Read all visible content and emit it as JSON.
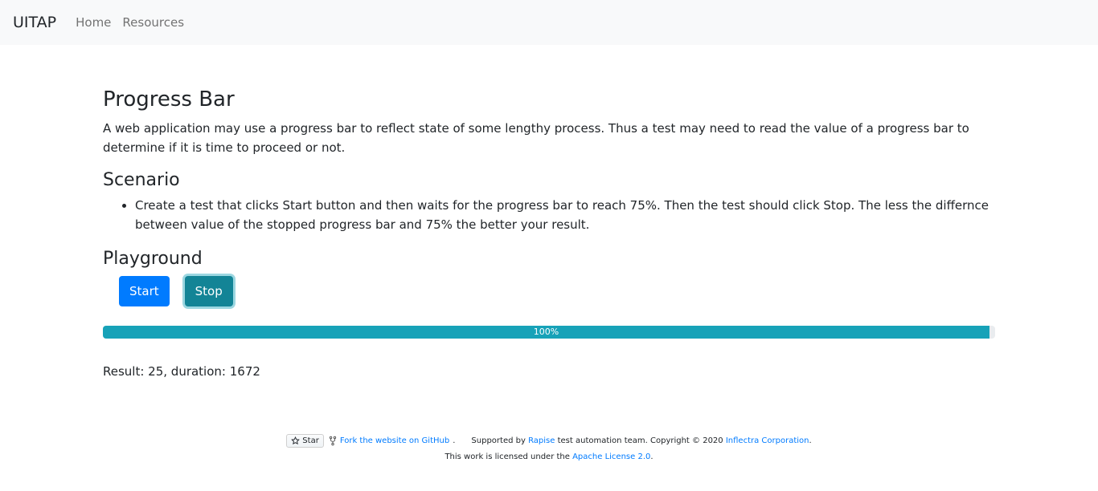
{
  "navbar": {
    "brand": "UITAP",
    "links": [
      "Home",
      "Resources"
    ]
  },
  "page": {
    "title": "Progress Bar",
    "description": "A web application may use a progress bar to reflect state of some lengthy process. Thus a test may need to read the value of a progress bar to determine if it is time to proceed or not.",
    "scenario_heading": "Scenario",
    "scenario_items": [
      "Create a test that clicks Start button and then waits for the progress bar to reach 75%. Then the test should click Stop. The less the differnce between value of the stopped progress bar and 75% the better your result."
    ],
    "playground_heading": "Playground",
    "start_label": "Start",
    "stop_label": "Stop",
    "progress": {
      "value": 100,
      "label": "100%"
    },
    "result": "Result: 25, duration: 1672"
  },
  "footer": {
    "star_label": "Star",
    "fork_text": "Fork the website on GitHub",
    "supported_prefix": "Supported by ",
    "rapise": "Rapise",
    "supported_suffix": " test automation team. Copyright © 2020 ",
    "inflectra": "Inflectra Corporation",
    "license_prefix": "This work is licensed under the ",
    "license_link": "Apache License 2.0"
  },
  "colors": {
    "primary": "#007bff",
    "info": "#17a2b8",
    "navbar_bg": "#f8f9fa"
  }
}
